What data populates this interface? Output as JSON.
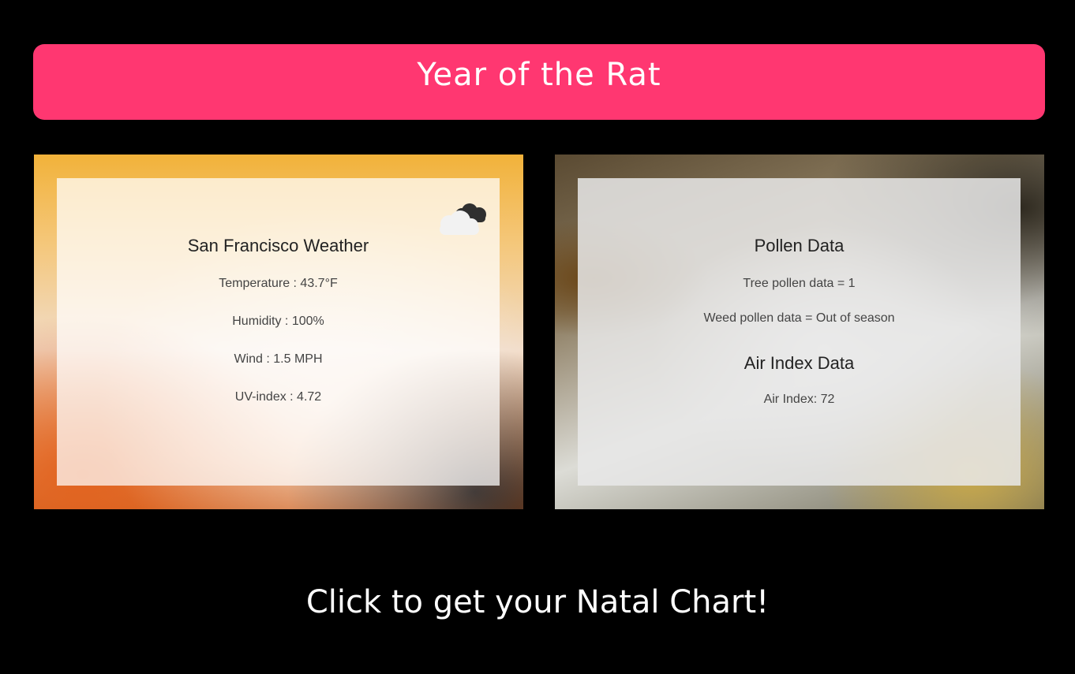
{
  "header": {
    "title": "Year of the Rat"
  },
  "weather": {
    "title": "San Francisco Weather",
    "temperature": "Temperature : 43.7°F",
    "humidity": "Humidity : 100%",
    "wind": "Wind : 1.5 MPH",
    "uv_index": "UV-index : 4.72",
    "icon": "cloud-icon"
  },
  "pollen": {
    "title": "Pollen Data",
    "tree": "Tree pollen data = 1",
    "weed": "Weed pollen data = Out of season"
  },
  "air": {
    "title": "Air Index Data",
    "index": "Air Index: 72"
  },
  "cta": {
    "label": "Click to get your Natal Chart!"
  },
  "colors": {
    "banner": "#ff3771",
    "background": "#000000",
    "text_light": "#ffffff"
  }
}
